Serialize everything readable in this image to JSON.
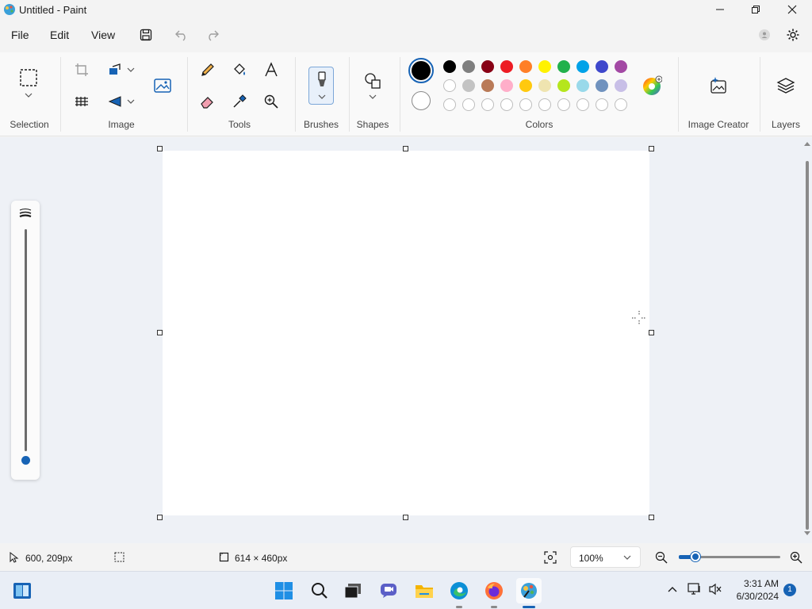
{
  "window": {
    "title": "Untitled - Paint"
  },
  "menu": {
    "items": [
      "File",
      "Edit",
      "View"
    ]
  },
  "ribbon": {
    "groups": {
      "selection": "Selection",
      "image": "Image",
      "tools": "Tools",
      "brushes": "Brushes",
      "shapes": "Shapes",
      "colors": "Colors",
      "image_creator": "Image Creator",
      "layers": "Layers"
    },
    "palette_row1": [
      "#000000",
      "#7f7f7f",
      "#880015",
      "#ed1c24",
      "#ff7f27",
      "#fff200",
      "#22b14c",
      "#00a2e8",
      "#3f48cc",
      "#a349a4"
    ],
    "palette_row2": [
      "#ffffff",
      "#c3c3c3",
      "#b97a57",
      "#ffaec9",
      "#ffc90e",
      "#efe4b0",
      "#b5e61d",
      "#99d9ea",
      "#7092be",
      "#c8bfe7"
    ],
    "primary_color": "#000000",
    "secondary_color": "#ffffff"
  },
  "status": {
    "cursor_position": "600, 209px",
    "canvas_size": "614 × 460px",
    "zoom_level": "100%"
  },
  "taskbar": {
    "time": "3:31 AM",
    "date": "6/30/2024",
    "notification_count": "1"
  }
}
